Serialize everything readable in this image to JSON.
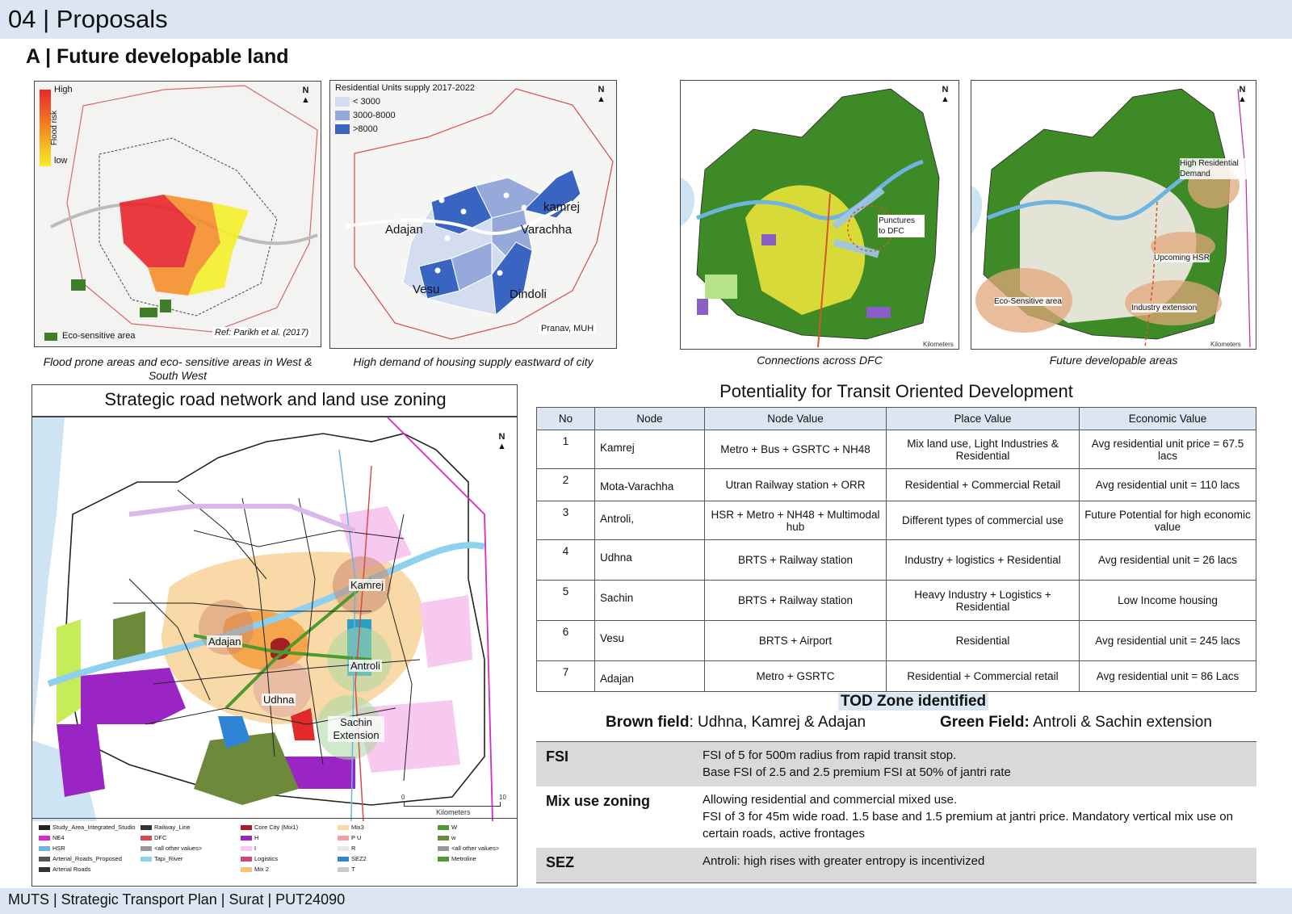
{
  "header": {
    "title": "04 | Proposals"
  },
  "subtitle": "A  | Future developable land",
  "maps": {
    "flood": {
      "legend_high": "High",
      "legend_axis": "Flood risk",
      "legend_low": "low",
      "north": "N",
      "eco_label": "Eco-sensitive area",
      "ref": "Ref: Parikh et al. (2017)",
      "caption": "Flood prone areas and eco- sensitive areas in West & South West",
      "colors": {
        "high": "#e8262b",
        "mid": "#f6881f",
        "low": "#f5ee2a",
        "eco": "#3e7d2a"
      }
    },
    "housing": {
      "legend_title": "Residential Units supply 2017-2022",
      "legend_items": [
        "< 3000",
        "3000-8000",
        ">8000"
      ],
      "legend_colors": [
        "#d4dcef",
        "#95a9da",
        "#3a64c2"
      ],
      "north": "N",
      "labels": {
        "adajan": "Adajan",
        "kamrej": "kamrej",
        "varachha": "Varachha",
        "vesu": "Vesu",
        "dindoli": "Dindoli"
      },
      "credit": "Pranav, MUH",
      "caption": "High demand of housing supply eastward of city"
    },
    "dfc": {
      "north": "N",
      "annotation": "Punctures to DFC",
      "scale": "Kilometers",
      "caption": "Connections across DFC"
    },
    "future": {
      "north": "N",
      "labels": {
        "high_res": "High Residential Demand",
        "hsr": "Upcoming HSR",
        "eco": "Eco-Sensitive area",
        "industry": "Industry extension"
      },
      "scale": "Kilometers",
      "caption": "Future developable areas"
    },
    "road": {
      "title": "Strategic road network and land use zoning",
      "north": "N",
      "labels": {
        "kamrej": "Kamrej",
        "adajan": "Adajan",
        "antroli": "Antroli",
        "udhna": "Udhna",
        "sachin": "Sachin Extension"
      },
      "scale_max": "10",
      "scale_min": "0",
      "scale_unit": "Kilometers",
      "legend": [
        "Study_Area_Integrated_Studio",
        "Railway_Line",
        "Core City (Mix1)",
        "Mix3",
        "W",
        "NE4",
        "DFC",
        "H",
        "P U",
        "w",
        "HSR",
        "<all other values>",
        "I",
        "R",
        "<all other values>",
        "Arterial_Roads_Proposed",
        "Tapi_River",
        "Logistics",
        "SEZ2",
        "Metroline",
        "Arterial Roads",
        "",
        "Mix 2",
        "T",
        ""
      ]
    }
  },
  "tod": {
    "title": "Potentiality for Transit Oriented Development",
    "headers": [
      "No",
      "Node",
      "Node Value",
      "Place Value",
      "Economic Value"
    ],
    "rows": [
      [
        "1",
        "Kamrej",
        "Metro + Bus + GSRTC + NH48",
        "Mix land use, Light Industries & Residential",
        "Avg residential unit price = 67.5 lacs"
      ],
      [
        "2",
        "Mota-Varachha",
        "Utran Railway station + ORR",
        "Residential + Commercial Retail",
        "Avg residential unit = 110 lacs"
      ],
      [
        "3",
        "Antroli,",
        "HSR + Metro + NH48 + Multimodal hub",
        "Different types of commercial use",
        "Future Potential for high economic value"
      ],
      [
        "4",
        "Udhna",
        "BRTS + Railway station",
        "Industry + logistics + Residential",
        "Avg residential unit = 26 lacs"
      ],
      [
        "5",
        "Sachin",
        "BRTS + Railway station",
        "Heavy Industry + Logistics + Residential",
        "Low Income housing"
      ],
      [
        "6",
        "Vesu",
        "BRTS + Airport",
        "Residential",
        "Avg residential unit = 245 lacs"
      ],
      [
        "7",
        "Adajan",
        "Metro + GSRTC",
        "Residential + Commercial retail",
        "Avg residential unit = 86 Lacs"
      ]
    ],
    "zone_title": "TOD Zone identified",
    "brown_label": "Brown field",
    "brown_value": ": Udhna, Kamrej & Adajan",
    "green_label": "Green Field:",
    "green_value": " Antroli & Sachin extension"
  },
  "policies": [
    {
      "key": "FSI",
      "lines": [
        "FSI of 5 for 500m radius from rapid transit stop.",
        "Base FSI of 2.5 and 2.5 premium FSI at 50% of jantri rate"
      ],
      "bg": "#d9d9d9"
    },
    {
      "key": "Mix use zoning",
      "lines": [
        "Allowing residential and commercial mixed use.",
        "FSI of 3 for 45m wide road. 1.5 base and 1.5 premium at jantri price. Mandatory vertical mix use on certain roads, active frontages"
      ],
      "bg": "#ffffff"
    },
    {
      "key": "SEZ",
      "lines": [
        "Antroli: high rises with greater entropy is incentivized"
      ],
      "bg": "#d9d9d9"
    }
  ],
  "footer": {
    "text": "MUTS | Strategic Transport Plan | Surat | PUT24090"
  }
}
